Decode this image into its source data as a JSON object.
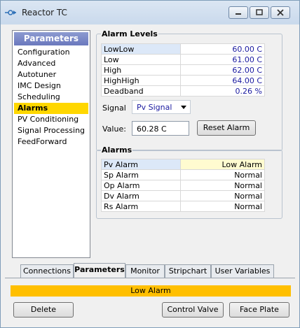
{
  "window": {
    "title": "Reactor TC"
  },
  "nav": {
    "header": "Parameters",
    "items": [
      "Configuration",
      "Advanced",
      "Autotuner",
      "IMC Design",
      "Scheduling",
      "Alarms",
      "PV Conditioning",
      "Signal Processing",
      "FeedForward"
    ],
    "selected": "Alarms"
  },
  "alarm_levels": {
    "title": "Alarm Levels",
    "rows": [
      {
        "label": "LowLow",
        "value": "60.00 C"
      },
      {
        "label": "Low",
        "value": "61.00 C"
      },
      {
        "label": "High",
        "value": "62.00 C"
      },
      {
        "label": "HighHigh",
        "value": "64.00 C"
      },
      {
        "label": "Deadband",
        "value": "0.26 %"
      }
    ],
    "signal_label": "Signal",
    "signal_value": "Pv Signal",
    "value_label": "Value:",
    "value_text": "60.28 C",
    "reset_button": "Reset Alarm"
  },
  "alarms": {
    "title": "Alarms",
    "rows": [
      {
        "label": "Pv Alarm",
        "status": "Low Alarm"
      },
      {
        "label": "Sp Alarm",
        "status": "Normal"
      },
      {
        "label": "Op Alarm",
        "status": "Normal"
      },
      {
        "label": "Dv Alarm",
        "status": "Normal"
      },
      {
        "label": "Rs Alarm",
        "status": "Normal"
      }
    ]
  },
  "tabs": [
    "Connections",
    "Parameters",
    "Monitor",
    "Stripchart",
    "User Variables"
  ],
  "active_tab": "Parameters",
  "status_bar": {
    "text": "Low Alarm",
    "color": "#ffbf00"
  },
  "buttons": {
    "delete": "Delete",
    "control_valve": "Control Valve",
    "face_plate": "Face Plate"
  }
}
